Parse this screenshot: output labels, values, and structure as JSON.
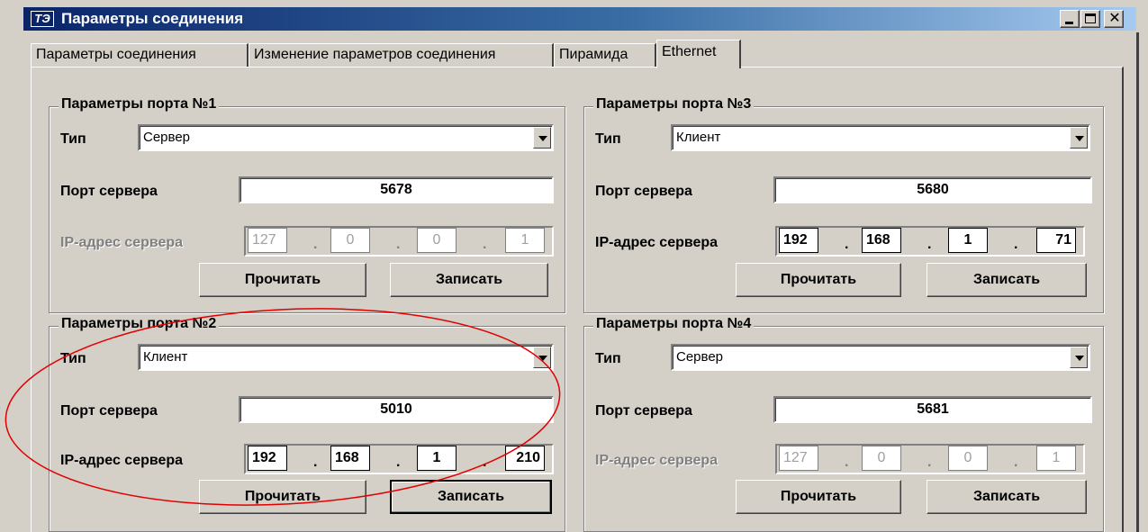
{
  "window": {
    "title": "Параметры соединения",
    "app_icon_text": "ТЭ",
    "controls": {
      "minimize": "minimize",
      "maximize": "maximize",
      "close": "✕"
    }
  },
  "tabs": [
    {
      "label": "Параметры соединения",
      "active": false
    },
    {
      "label": "Изменение параметров соединения",
      "active": false
    },
    {
      "label": "Пирамида",
      "active": false
    },
    {
      "label": "Ethernet",
      "active": true
    }
  ],
  "ports": [
    {
      "title": "Параметры порта №1",
      "type_label": "Тип",
      "type_value": "Сервер",
      "server_port_label": "Порт сервера",
      "server_port": "5678",
      "ip_label": "IP-адрес сервера",
      "ip_enabled": false,
      "ip": [
        "127",
        "0",
        "0",
        "1"
      ],
      "read_button": "Прочитать",
      "write_button": "Записать"
    },
    {
      "title": "Параметры порта №2",
      "type_label": "Тип",
      "type_value": "Клиент",
      "server_port_label": "Порт сервера",
      "server_port": "5010",
      "ip_label": "IP-адрес сервера",
      "ip_enabled": true,
      "ip": [
        "192",
        "168",
        "1",
        "210"
      ],
      "read_button": "Прочитать",
      "write_button": "Записать"
    },
    {
      "title": "Параметры порта №3",
      "type_label": "Тип",
      "type_value": "Клиент",
      "server_port_label": "Порт сервера",
      "server_port": "5680",
      "ip_label": "IP-адрес сервера",
      "ip_enabled": true,
      "ip": [
        "192",
        "168",
        "1",
        "71"
      ],
      "read_button": "Прочитать",
      "write_button": "Записать"
    },
    {
      "title": "Параметры порта №4",
      "type_label": "Тип",
      "type_value": "Сервер",
      "server_port_label": "Порт сервера",
      "server_port": "5681",
      "ip_label": "IP-адрес сервера",
      "ip_enabled": false,
      "ip": [
        "127",
        "0",
        "0",
        "1"
      ],
      "read_button": "Прочитать",
      "write_button": "Записать"
    }
  ],
  "ip_separator": ".",
  "colors": {
    "face": "#d4d0c8",
    "title_start": "#0a246a",
    "title_end": "#a6caf0",
    "highlight_ellipse": "#e00000",
    "disabled_text": "#808080"
  }
}
